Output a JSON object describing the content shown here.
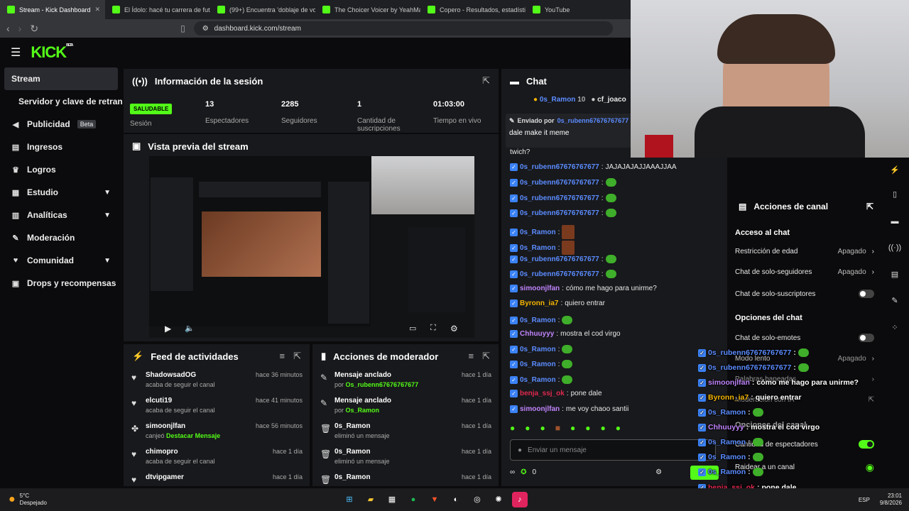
{
  "browser": {
    "tabs": [
      {
        "title": "Stream - Kick Dashboard",
        "active": true
      },
      {
        "title": "El Ídolo: hacé tu carrera de futbolista"
      },
      {
        "title": "(99+) Encuentra 'doblaje de voz para..."
      },
      {
        "title": "The Choicer Voicer by YeahMaybe"
      },
      {
        "title": "Copero - Resultados, estadísticas, al..."
      },
      {
        "title": "YouTube"
      }
    ],
    "url": "dashboard.kick.com/stream"
  },
  "brand": {
    "logo": "KICK",
    "sup": "BETA",
    "accent": "#53fc18"
  },
  "sidebar": {
    "items": [
      {
        "label": "Stream",
        "icon": "video-icon"
      },
      {
        "label": "Servidor y clave de retransmisión"
      },
      {
        "label": "Publicidad",
        "badge": "Beta",
        "icon": "megaphone-icon"
      },
      {
        "label": "Ingresos",
        "icon": "wallet-icon"
      },
      {
        "label": "Logros",
        "icon": "trophy-icon"
      },
      {
        "label": "Estudio",
        "icon": "studio-icon"
      },
      {
        "label": "Analíticas",
        "icon": "chart-icon"
      },
      {
        "label": "Moderación",
        "icon": "wrench-icon"
      },
      {
        "label": "Comunidad",
        "icon": "community-icon"
      },
      {
        "label": "Drops y recompensas",
        "icon": "gift-icon"
      }
    ]
  },
  "session": {
    "title": "Información de la sesión",
    "status": "SALUDABLE",
    "status_label": "Sesión",
    "viewers": "13",
    "viewers_label": "Espectadores",
    "followers": "2285",
    "followers_label": "Seguidores",
    "subs": "1",
    "subs_label": "Cantidad de suscripciones",
    "time": "01:03:00",
    "time_label": "Tiempo en vivo"
  },
  "preview": {
    "title": "Vista previa del stream"
  },
  "feed": {
    "title": "Feed de actividades",
    "rows": [
      {
        "name": "ShadowsadOG",
        "sub": "acaba de seguir el canal",
        "time": "hace 36 minutos"
      },
      {
        "name": "elcuti19",
        "sub": "acaba de seguir el canal",
        "time": "hace 41 minutos"
      },
      {
        "name": "simoonjlfan",
        "sub": "canjeó",
        "sub_hl": "Destacar Mensaje",
        "time": "hace 56 minutos"
      },
      {
        "name": "chimopro",
        "sub": "acaba de seguir el canal",
        "time": "hace 1 día"
      },
      {
        "name": "dtvipgamer",
        "sub": "",
        "time": "hace 1 día"
      }
    ]
  },
  "modactions": {
    "title": "Acciones de moderador",
    "rows": [
      {
        "name": "Mensaje anclado",
        "sub": "por",
        "sub_hl": "Os_rubenn67676767677",
        "time": "hace 1 día"
      },
      {
        "name": "Mensaje anclado",
        "sub": "por",
        "sub_hl": "Os_Ramon",
        "time": "hace 1 día"
      },
      {
        "name": "0s_Ramon",
        "sub": "eliminó un mensaje",
        "time": "hace 1 día"
      },
      {
        "name": "0s_Ramon",
        "sub": "eliminó un mensaje",
        "time": "hace 1 día"
      },
      {
        "name": "0s_Ramon",
        "sub": "",
        "time": "hace 1 día"
      }
    ]
  },
  "chat": {
    "title": "Chat",
    "top_users": [
      {
        "name": "0s_Ramon",
        "count": "10"
      },
      {
        "name": "cf_joaco"
      }
    ],
    "pinned_by": "Enviado por",
    "pinned_user": "0s_rubenn67676767677",
    "pinned_msg": "dale make it meme",
    "lines": [
      {
        "text": "twich?"
      },
      {
        "user": "0s_rubenn67676767677",
        "color": "#5b8cff",
        "msg": "JAJAJAJAJJAAAJJAA"
      },
      {
        "user": "0s_rubenn67676767677",
        "color": "#5b8cff",
        "emote": true
      },
      {
        "user": "0s_rubenn67676767677",
        "color": "#5b8cff",
        "emote": true
      },
      {
        "user": "0s_rubenn67676767677",
        "color": "#5b8cff",
        "emote": true
      },
      {
        "user": "0s_Ramon",
        "color": "#5b8cff",
        "emote": true,
        "big": true
      },
      {
        "user": "0s_Ramon",
        "color": "#5b8cff",
        "emote": true,
        "big": true
      },
      {
        "user": "0s_rubenn67676767677",
        "color": "#5b8cff",
        "emote": true
      },
      {
        "user": "0s_rubenn67676767677",
        "color": "#5b8cff",
        "emote": true
      },
      {
        "user": "simoonjlfan",
        "color": "#c084fc",
        "msg": "cómo me hago para unirme?"
      },
      {
        "user": "Byronn_ia7",
        "color": "#f4b400",
        "msg": "quiero entrar"
      },
      {
        "user": "0s_Ramon",
        "color": "#5b8cff",
        "emote": true
      },
      {
        "user": "Chhuuyyy",
        "color": "#c084fc",
        "msg": "mostra el cod virgo"
      },
      {
        "user": "0s_Ramon",
        "color": "#5b8cff",
        "emote": true
      },
      {
        "user": "0s_Ramon",
        "color": "#5b8cff",
        "emote": true
      },
      {
        "user": "0s_Ramon",
        "color": "#5b8cff",
        "emote": true
      },
      {
        "user": "benja_ssj_ok",
        "color": "#e0284f",
        "msg": "pone dale"
      },
      {
        "user": "simoonjlfan",
        "color": "#c084fc",
        "msg": "me voy chaoo santii"
      }
    ],
    "input_placeholder": "Enviar un mensaje",
    "points": "0"
  },
  "actions": {
    "title": "Acciones de canal",
    "access_title": "Acceso al chat",
    "age": "Restricción de edad",
    "age_val": "Apagado",
    "followers": "Chat de solo-seguidores",
    "followers_val": "Apagado",
    "subs": "Chat de solo-suscriptores",
    "options_title": "Opciones del chat",
    "emotes": "Chat de solo-emotes",
    "slow": "Modo lento",
    "slow_val": "Apagado",
    "banned": "Palabras baneadas",
    "ai": "Moderación con IA",
    "viewers": "Cantidad de espectadores",
    "raid": "Raidear a un canal",
    "ops": "Opciones del canal"
  },
  "overlay": {
    "lines": [
      {
        "user": "0s_rubenn67676767677",
        "color": "#5b8cff",
        "emote": true
      },
      {
        "user": "0s_rubenn67676767677",
        "color": "#5b8cff",
        "emote": true
      },
      {
        "user": "simoonjlfan",
        "color": "#c084fc",
        "msg": "cómo me hago para unirme?"
      },
      {
        "user": "Byronn_ia7",
        "color": "#f4b400",
        "msg": "quiero entrar"
      },
      {
        "user": "0s_Ramon",
        "color": "#5b8cff",
        "emote": true
      },
      {
        "user": "Chhuuyyy",
        "color": "#c084fc",
        "msg": "mostra el cod virgo"
      },
      {
        "user": "0s_Ramon",
        "color": "#5b8cff",
        "emote": true
      },
      {
        "user": "0s_Ramon",
        "color": "#5b8cff",
        "emote": true
      },
      {
        "user": "0s_Ramon",
        "color": "#5b8cff",
        "emote": true
      },
      {
        "user": "benja_ssj_ok",
        "color": "#e0284f",
        "msg": "pone dale"
      },
      {
        "user": "simoonjlfan",
        "color": "#c084fc",
        "msg": "me voy chaoo santii"
      }
    ]
  },
  "taskbar": {
    "weather_temp": "5°C",
    "weather_desc": "Despejado",
    "lang": "ESP",
    "time": "23:01",
    "date": "9/8/2026"
  }
}
